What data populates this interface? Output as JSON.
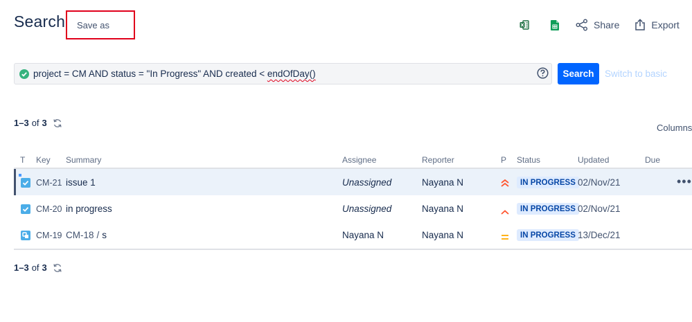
{
  "header": {
    "title": "Search",
    "save_as_label": "Save as",
    "share_label": "Share",
    "export_label": "Export"
  },
  "search": {
    "jql_prefix": "project = CM AND status = \"In Progress\" AND created < ",
    "jql_function": "endOfDay()",
    "search_button": "Search",
    "switch_label": "Switch to basic"
  },
  "results": {
    "range": "1–3",
    "of_label": "of",
    "total": "3",
    "columns_label": "Columns"
  },
  "table": {
    "headers": {
      "type": "T",
      "key": "Key",
      "summary": "Summary",
      "assignee": "Assignee",
      "reporter": "Reporter",
      "priority": "P",
      "status": "Status",
      "updated": "Updated",
      "due": "Due"
    },
    "rows": [
      {
        "type_icon": "task-icon",
        "key": "CM-21",
        "summary": "issue 1",
        "assignee": "Unassigned",
        "reporter": "Nayana N",
        "priority_icon": "priority-highest-icon",
        "status": "IN PROGRESS",
        "updated": "02/Nov/21",
        "due": ""
      },
      {
        "type_icon": "task-icon",
        "key": "CM-20",
        "summary": "in progress",
        "assignee": "Unassigned",
        "reporter": "Nayana N",
        "priority_icon": "priority-high-icon",
        "status": "IN PROGRESS",
        "updated": "02/Nov/21",
        "due": ""
      },
      {
        "type_icon": "subtask-icon",
        "key": "CM-19",
        "parent": "CM-18",
        "separator": "/",
        "summary": "s",
        "assignee": "Nayana N",
        "reporter": "Nayana N",
        "priority_icon": "priority-medium-icon",
        "status": "IN PROGRESS",
        "updated": "13/Dec/21",
        "due": ""
      }
    ]
  },
  "colors": {
    "primary": "#0065ff",
    "highlight_border": "#e0001b",
    "status_bg": "#deebff",
    "status_text": "#0747a6",
    "priority_high": "#ff5630",
    "priority_medium": "#ffab00",
    "excel_green": "#1d6f42",
    "sheets_green": "#0f9d58"
  }
}
